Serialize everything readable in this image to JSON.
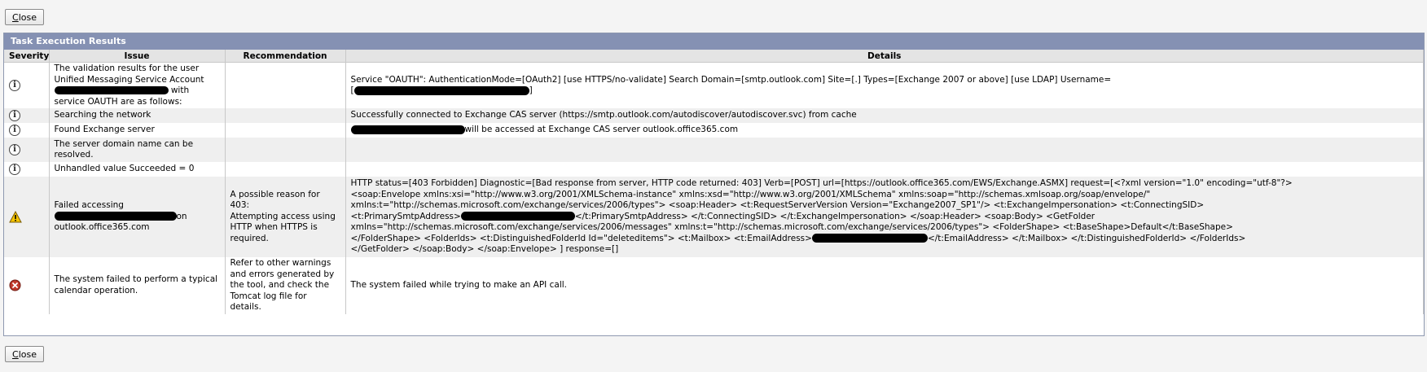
{
  "buttons": {
    "close_first": "C",
    "close_rest": "lose"
  },
  "panel": {
    "title": "Task Execution Results"
  },
  "columns": {
    "severity": "Severity",
    "issue": "Issue",
    "recommendation": "Recommendation",
    "details": "Details"
  },
  "rows": [
    {
      "severity": "info-icon",
      "issue_line1": "The validation results for the user",
      "issue_line2": "Unified Messaging Service Account",
      "issue_line3_suffix": "with",
      "issue_line4": "service OAUTH are as follows:",
      "recommendation": "",
      "details_line1": "Service \"OAUTH\": AuthenticationMode=[OAuth2] [use HTTPS/no-validate] Search Domain=[smtp.outlook.com] Site=[.] Types=[Exchange 2007 or above] [use LDAP] Username=",
      "details_line2_prefix": "[",
      "details_line2_suffix": "]"
    },
    {
      "severity": "info-icon",
      "issue": "Searching the network",
      "recommendation": "",
      "details": "Successfully connected to Exchange CAS server (https://smtp.outlook.com/autodiscover/autodiscover.svc) from cache"
    },
    {
      "severity": "info-icon",
      "issue": "Found Exchange server",
      "recommendation": "",
      "details_suffix": "will be accessed at Exchange CAS server outlook.office365.com"
    },
    {
      "severity": "info-icon",
      "issue_line1": "The server domain name can be",
      "issue_line2": "resolved.",
      "recommendation": "",
      "details": ""
    },
    {
      "severity": "info-icon",
      "issue": "Unhandled value Succeeded = 0",
      "recommendation": "",
      "details": ""
    },
    {
      "severity": "warning-icon",
      "issue_line1": "Failed accessing",
      "issue_line2_suffix": "on",
      "issue_line3": "outlook.office365.com",
      "recommendation_line1": "A possible reason for 403:",
      "recommendation_line2": "Attempting access using",
      "recommendation_line3": "HTTP when HTTPS is",
      "recommendation_line4": "required.",
      "details_line1": "HTTP status=[403 Forbidden] Diagnostic=[Bad response from server, HTTP code returned: 403] Verb=[POST] url=[https://outlook.office365.com/EWS/Exchange.ASMX] request=[<?xml version=\"1.0\" encoding=\"utf-8\"?>",
      "details_line2": "<soap:Envelope xmlns:xsi=\"http://www.w3.org/2001/XMLSchema-instance\" xmlns:xsd=\"http://www.w3.org/2001/XMLSchema\" xmlns:soap=\"http://schemas.xmlsoap.org/soap/envelope/\"",
      "details_line3": "xmlns:t=\"http://schemas.microsoft.com/exchange/services/2006/types\"> <soap:Header> <t:RequestServerVersion Version=\"Exchange2007_SP1\"/> <t:ExchangeImpersonation> <t:ConnectingSID>",
      "details_line4_prefix": "<t:PrimarySmtpAddress>",
      "details_line4_suffix": "</t:PrimarySmtpAddress> </t:ConnectingSID> </t:ExchangeImpersonation> </soap:Header> <soap:Body> <GetFolder",
      "details_line5": "xmlns=\"http://schemas.microsoft.com/exchange/services/2006/messages\" xmlns:t=\"http://schemas.microsoft.com/exchange/services/2006/types\"> <FolderShape> <t:BaseShape>Default</t:BaseShape>",
      "details_line6_prefix": "</FolderShape> <FolderIds> <t:DistinguishedFolderId Id=\"deleteditems\"> <t:Mailbox> <t:EmailAddress>",
      "details_line6_suffix": "</t:EmailAddress> </t:Mailbox> </t:DistinguishedFolderId> </FolderIds>",
      "details_line7": "</GetFolder> </soap:Body> </soap:Envelope> ] response=[]"
    },
    {
      "severity": "error-icon",
      "issue_line1": "The system failed to perform a typical",
      "issue_line2": "calendar operation.",
      "recommendation_line1": "Refer to other warnings",
      "recommendation_line2": "and errors generated by",
      "recommendation_line3": "the tool, and check the",
      "recommendation_line4": "Tomcat log file for details.",
      "details": "The system failed while trying to make an API call."
    }
  ],
  "colors": {
    "panel_header": "#8591b3",
    "warning": "#f5c400",
    "error": "#c0392b"
  }
}
